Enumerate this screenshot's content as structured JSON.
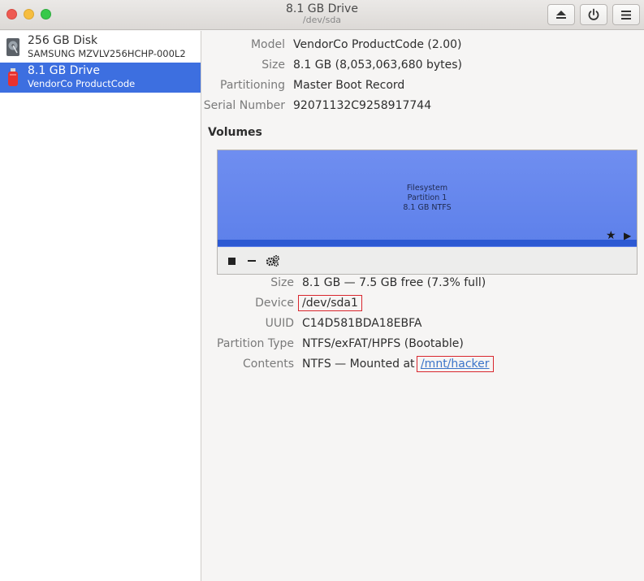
{
  "window": {
    "title": "8.1 GB Drive",
    "subtitle": "/dev/sda",
    "buttons": {
      "eject": "eject-icon",
      "power": "power-icon",
      "menu": "menu-icon"
    }
  },
  "sidebar": {
    "items": [
      {
        "name": "256 GB Disk",
        "sub": "SAMSUNG MZVLV256HCHP-000L2",
        "icon": "hard-disk-icon",
        "selected": false
      },
      {
        "name": "8.1 GB Drive",
        "sub": "VendorCo ProductCode",
        "icon": "usb-drive-icon",
        "selected": true
      }
    ]
  },
  "drive": {
    "model_label": "Model",
    "model": "VendorCo ProductCode (2.00)",
    "size_label": "Size",
    "size": "8.1 GB (8,053,063,680 bytes)",
    "partitioning_label": "Partitioning",
    "partitioning": "Master Boot Record",
    "serial_label": "Serial Number",
    "serial": "92071132C9258917744"
  },
  "volumes": {
    "heading": "Volumes",
    "partition": {
      "line1": "Filesystem",
      "line2": "Partition 1",
      "line3": "8.1 GB NTFS"
    },
    "tools": [
      "stop-icon",
      "minus-icon",
      "gears-icon"
    ]
  },
  "partition": {
    "size_label": "Size",
    "size": "8.1 GB — 7.5 GB free (7.3% full)",
    "device_label": "Device",
    "device": "/dev/sda1",
    "uuid_label": "UUID",
    "uuid": "C14D581BDA18EBFA",
    "type_label": "Partition Type",
    "type": "NTFS/exFAT/HPFS (Bootable)",
    "contents_label": "Contents",
    "contents_prefix": "NTFS — Mounted at ",
    "mount_point": "/mnt/hacker"
  },
  "colors": {
    "selection": "#3d6fe0",
    "partition": "#6f8ef0",
    "highlight": "#d9272e",
    "link": "#3b74c9"
  }
}
